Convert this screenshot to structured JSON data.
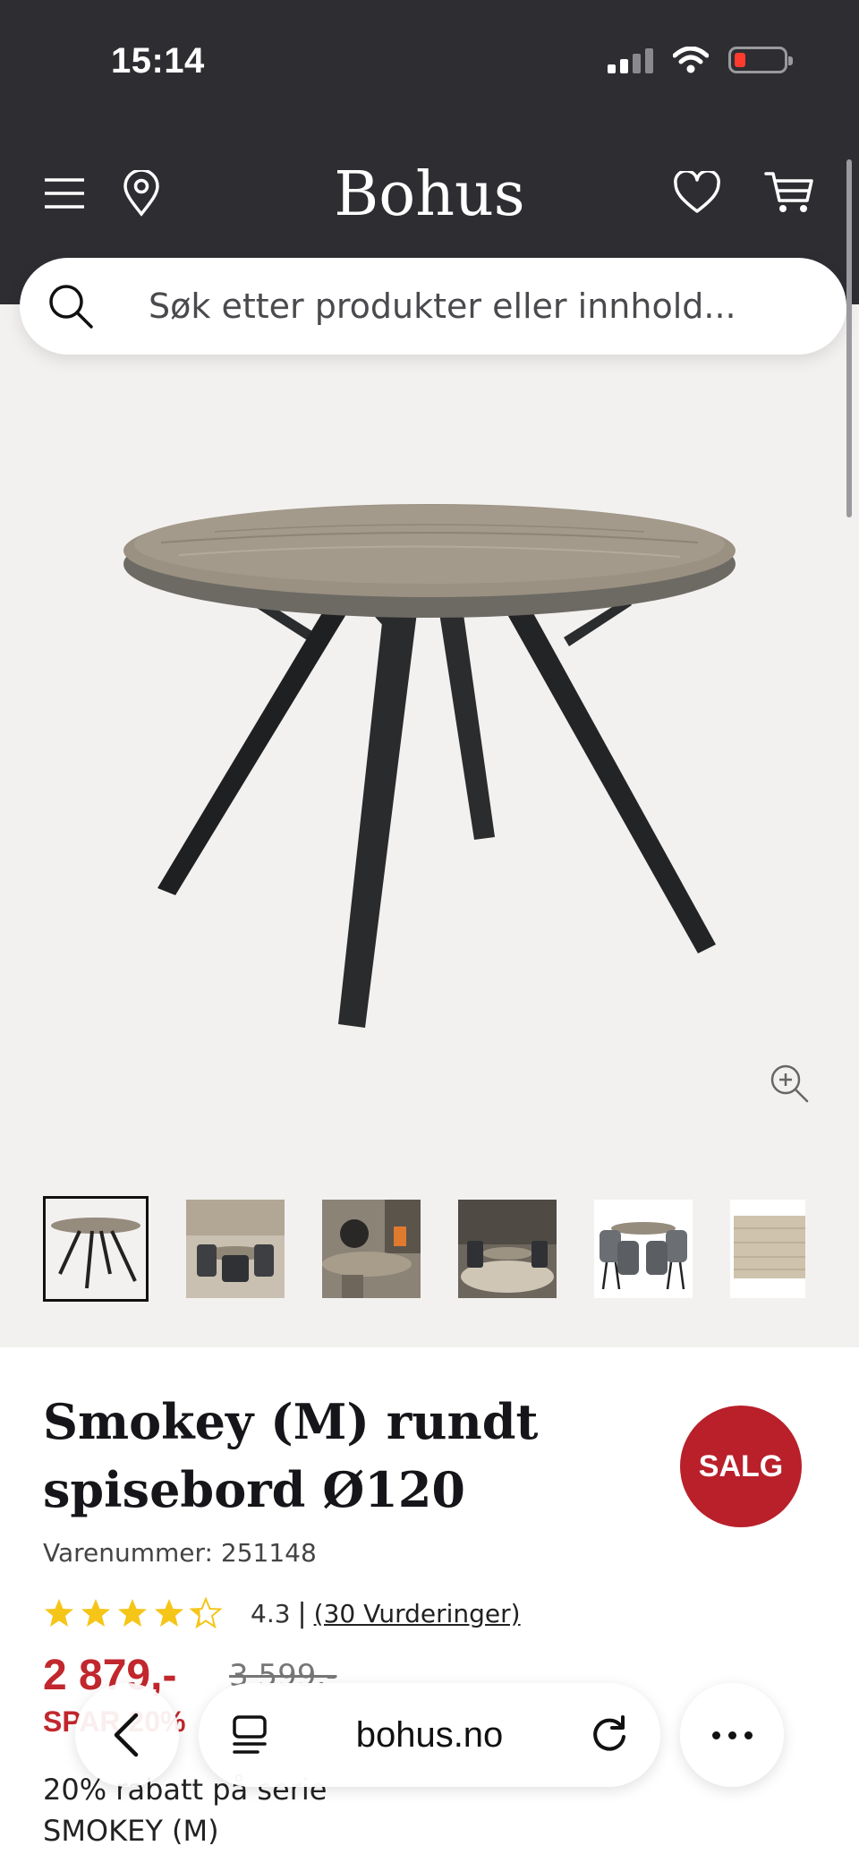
{
  "status_bar": {
    "time": "15:14"
  },
  "header": {
    "logo": "Bohus",
    "icons": [
      "menu-icon",
      "location-pin-icon",
      "heart-icon",
      "cart-icon"
    ]
  },
  "search": {
    "placeholder": "Søk etter produkter eller innhold..."
  },
  "gallery": {
    "thumbnails": [
      "table-product",
      "dining-room-scene-1",
      "table-closeup-scene",
      "dining-room-scene-2",
      "table-with-chairs",
      "wood-surface-sample"
    ],
    "active_index": 0
  },
  "product": {
    "title": "Smokey (M) rundt spisebord Ø120",
    "sku": "Varenummer: 251148",
    "badge": "SALG",
    "rating_value": "4.3",
    "rating_separator": "|",
    "rating_count": "(30 Vurderinger)",
    "rating_stars": 4.3,
    "price": "2 879,-",
    "old_price": "3 599,-",
    "savings": "SPAR 20%",
    "promo": "20% rabatt på serie SMOKEY (M)"
  },
  "browser": {
    "url": "bohus.no"
  },
  "colors": {
    "header_bg": "#2e2e32",
    "sale_red": "#c1272d",
    "star": "#f5c518",
    "page_bg": "#f3f1ef"
  }
}
